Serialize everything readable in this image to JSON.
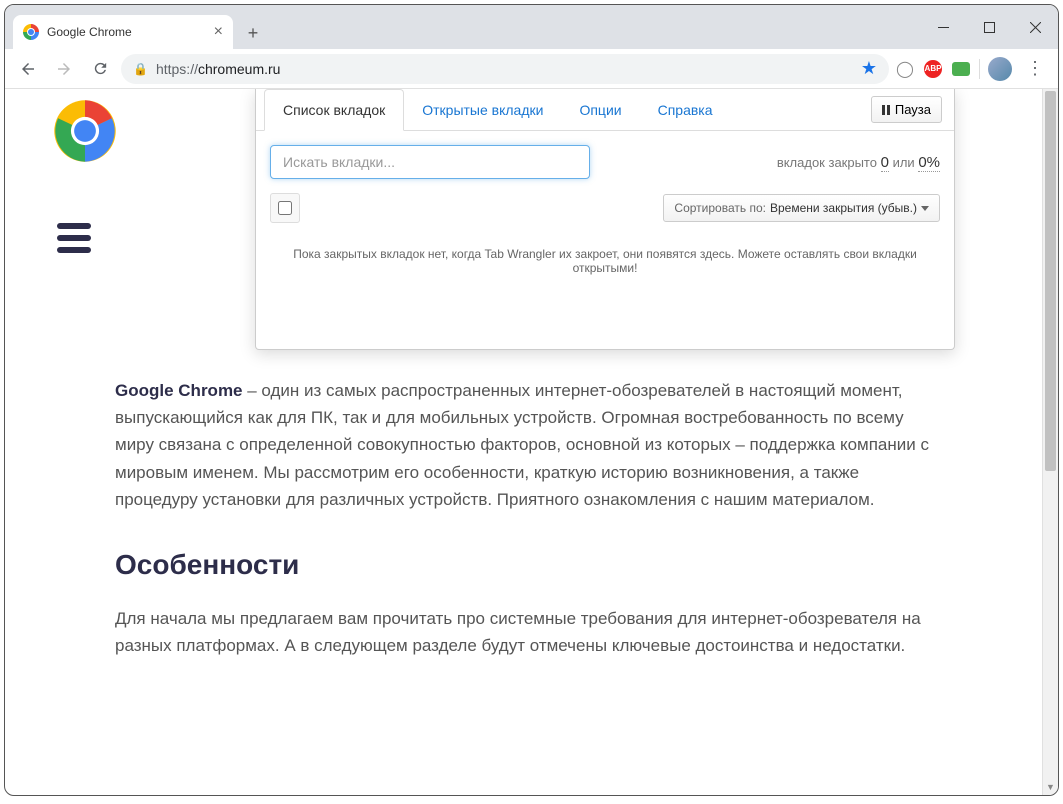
{
  "browser": {
    "tab_title": "Google Chrome",
    "url_proto": "https://",
    "url_host": "chromeum.ru"
  },
  "popup": {
    "tabs": {
      "list": "Список вкладок",
      "open": "Открытые вкладки",
      "options": "Опции",
      "help": "Справка"
    },
    "pause_label": "Пауза",
    "search_placeholder": "Искать вкладки...",
    "closed_label": "вкладок закрыто",
    "closed_count": "0",
    "closed_or": "или",
    "closed_pct": "0%",
    "sort_label": "Сортировать по:",
    "sort_value": "Времени закрытия (убыв.)",
    "empty_msg": "Пока закрытых вкладок нет, когда Tab Wrangler их закроет, они появятся здесь. Можете оставлять свои вкладки открытыми!"
  },
  "article": {
    "p1_bold": "Google Chrome",
    "p1_rest": " – один из самых распространенных интернет-обозревателей в настоящий момент, выпускающийся как для ПК, так и для мобильных устройств. Огромная востребованность по всему миру связана с определенной совокупностью факторов, основной из которых – поддержка компании с мировым именем. Мы рассмотрим его особенности, краткую историю возникновения, а также процедуру установки для различных устройств. Приятного ознакомления с нашим материалом.",
    "h2": "Особенности",
    "p2": "Для начала мы предлагаем вам прочитать про системные требования для интернет-обозревателя на разных платформах. А в следующем разделе будут отмечены ключевые достоинства и недостатки."
  }
}
